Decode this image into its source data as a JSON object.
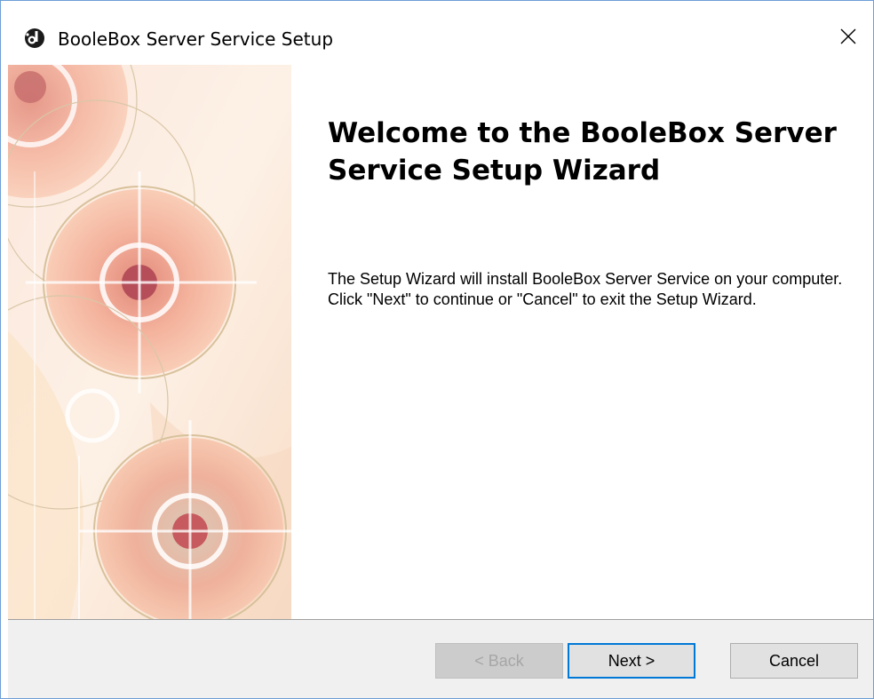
{
  "window": {
    "title": "BooleBox Server Service Setup",
    "app_icon": "boolebox-logo-icon",
    "close_icon": "close-icon"
  },
  "welcome": {
    "title": "Welcome to the BooleBox Server Service Setup Wizard",
    "description": "The Setup Wizard will install BooleBox Server Service on your computer.  Click \"Next\" to continue or \"Cancel\" to exit the Setup Wizard."
  },
  "buttons": {
    "back": "< Back",
    "next": "Next >",
    "cancel": "Cancel"
  },
  "colors": {
    "accent": "#0078d7",
    "footer_bg": "#f0f0f0",
    "art_peach": "#f2b49c"
  }
}
